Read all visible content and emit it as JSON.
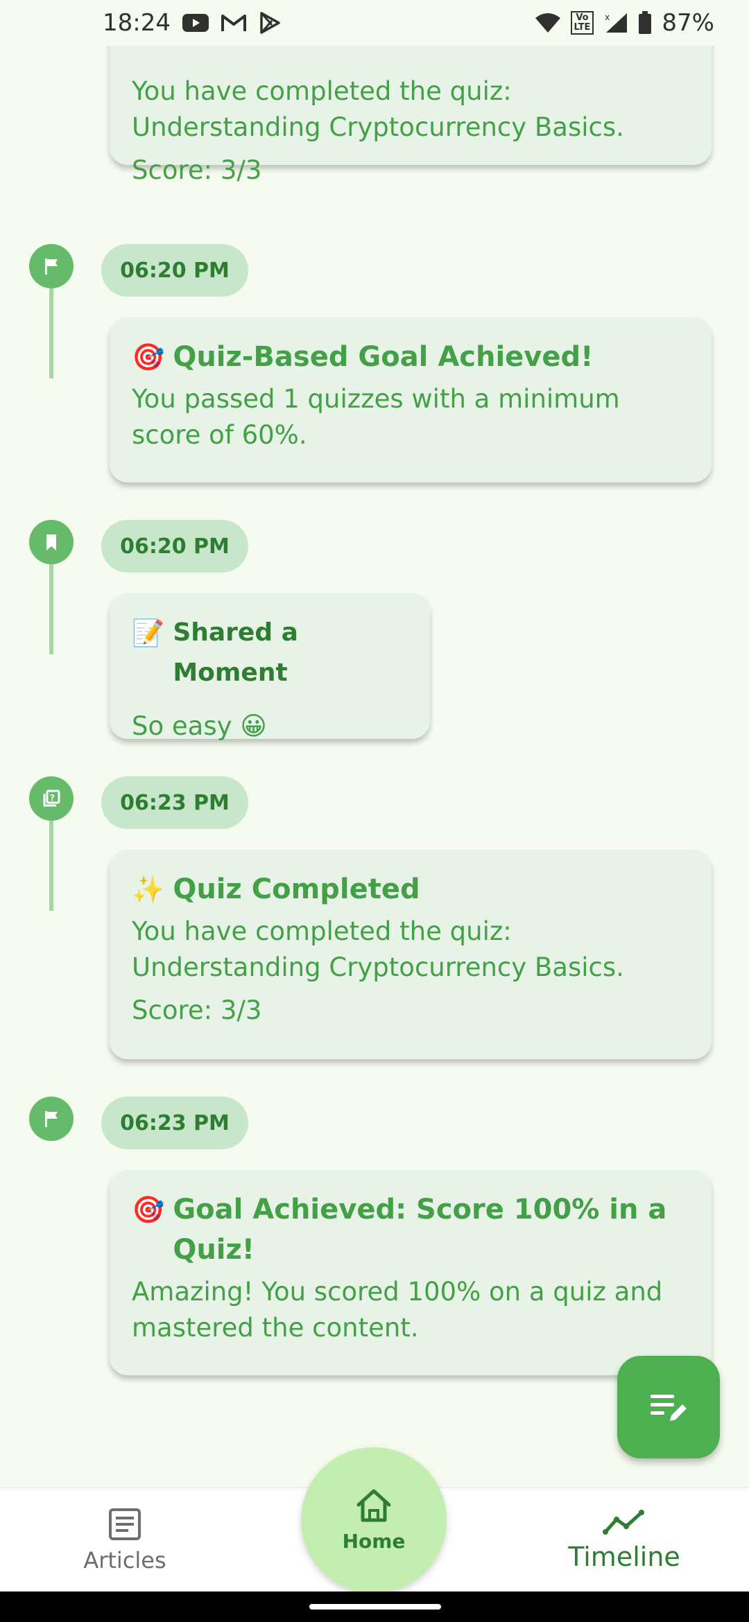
{
  "status_bar": {
    "time": "18:24",
    "battery": "87%",
    "lte_top": "Vo",
    "lte_bottom": "LTE"
  },
  "timeline": {
    "top_card": {
      "body": "You have completed the quiz: Understanding Cryptocurrency Basics.",
      "score": "Score: 3/3"
    },
    "entries": [
      {
        "time": "06:20 PM",
        "emoji": "🎯",
        "title": "Quiz-Based Goal Achieved!",
        "body": "You passed 1 quizzes with a minimum score of 60%.",
        "icon": "flag-icon"
      },
      {
        "time": "06:20 PM",
        "emoji": "📝",
        "title": "Shared a Moment",
        "body": "So easy 😀",
        "icon": "bookmark-icon"
      },
      {
        "time": "06:23 PM",
        "emoji": "✨",
        "title": "Quiz Completed",
        "body": "You have completed the quiz: Understanding Cryptocurrency Basics.",
        "score": "Score: 3/3",
        "icon": "quiz-icon"
      },
      {
        "time": "06:23 PM",
        "emoji": "🎯",
        "title": "Goal Achieved: Score 100% in a Quiz!",
        "body": "Amazing! You scored 100% on a quiz and mastered the content.",
        "icon": "flag-icon"
      }
    ]
  },
  "nav": {
    "articles": "Articles",
    "home": "Home",
    "timeline": "Timeline"
  },
  "colors": {
    "accent": "#43a047",
    "dark_green": "#2e7d32",
    "card_bg": "#e6f3e6",
    "chip_bg": "#c8e6c9",
    "fab_bg": "#4caf50",
    "home_bg": "#c3eeb0"
  }
}
